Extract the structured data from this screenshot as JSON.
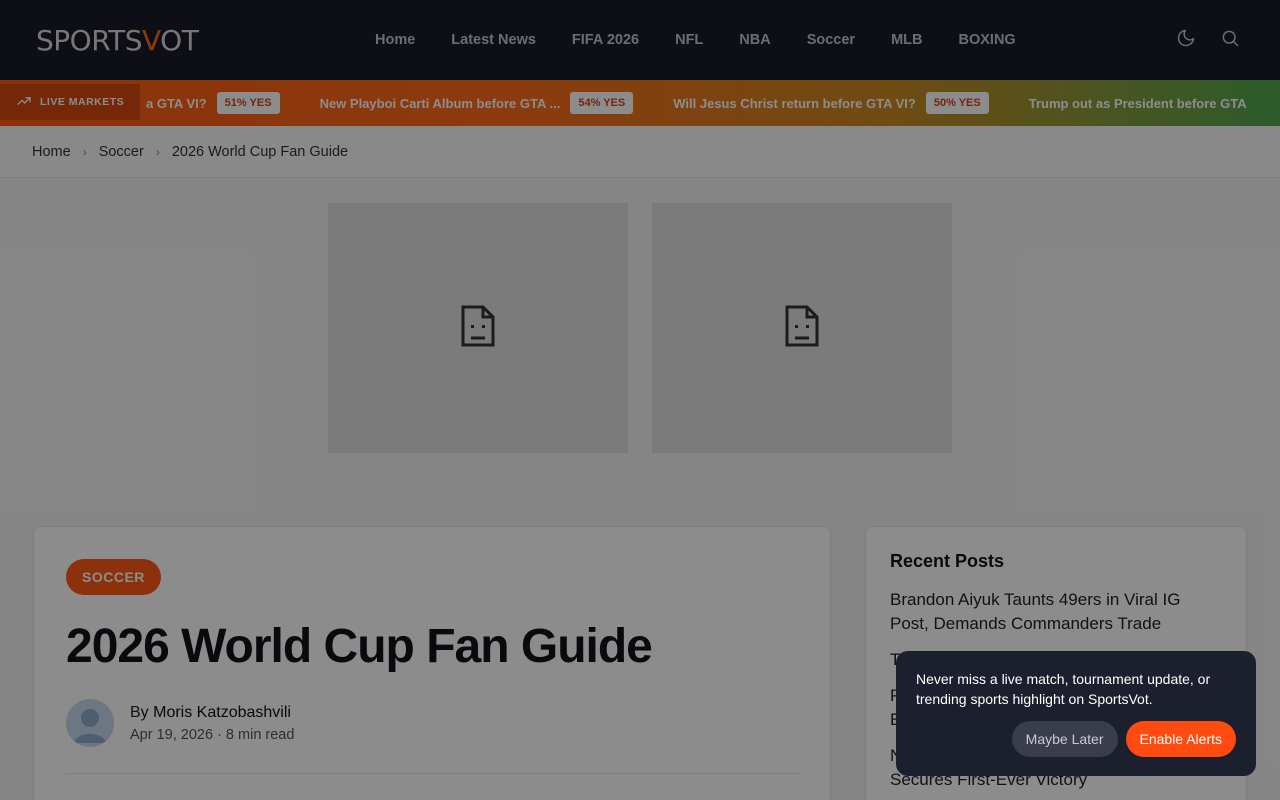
{
  "header": {
    "logo_prefix": "SPORTS",
    "logo_v": "V",
    "logo_suffix": "OT",
    "nav": [
      "Home",
      "Latest News",
      "FIFA 2026",
      "NFL",
      "NBA",
      "Soccer",
      "MLB",
      "BOXING"
    ]
  },
  "ticker": {
    "label": "LIVE MARKETS",
    "items": [
      {
        "question": "a GTA VI?",
        "odds": "51% YES"
      },
      {
        "question": "New Playboi Carti Album before GTA ...",
        "odds": "54% YES"
      },
      {
        "question": "Will Jesus Christ return before GTA VI?",
        "odds": "50% YES"
      },
      {
        "question": "Trump out as President before GTA",
        "odds": ""
      }
    ]
  },
  "breadcrumb": {
    "home": "Home",
    "category": "Soccer",
    "current": "2026 World Cup Fan Guide"
  },
  "article": {
    "category": "SOCCER",
    "title": "2026 World Cup Fan Guide",
    "by": "By",
    "author": "Moris Katzobashvili",
    "meta": "Apr 19, 2026 · 8 min read"
  },
  "sidebar": {
    "title": "Recent Posts",
    "posts": [
      "Brandon Aiyuk Taunts 49ers in Viral IG Post, Demands Commanders Trade",
      "Th",
      "P",
      "E",
      "N",
      "Secures First-Ever Victory"
    ]
  },
  "popup": {
    "text": "Never miss a live match, tournament update, or trending sports highlight on SportsVot.",
    "later": "Maybe Later",
    "enable": "Enable Alerts"
  },
  "colors": {
    "accent": "#ff5a14",
    "header_bg": "#1a1d29"
  }
}
